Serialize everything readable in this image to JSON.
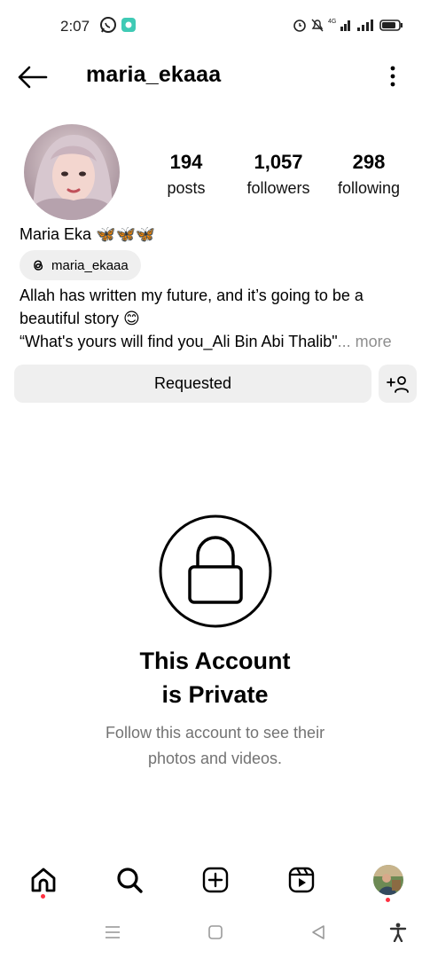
{
  "status_bar": {
    "time": "2:07",
    "icons": [
      "whatsapp-icon",
      "app-notification-icon",
      "alarm-icon",
      "mute-icon",
      "4g-signal-icon",
      "signal-icon",
      "battery-icon"
    ]
  },
  "header": {
    "username": "maria_ekaaa",
    "back_icon": "arrow-left-icon",
    "menu_icon": "more-vertical-icon"
  },
  "profile": {
    "stats": [
      {
        "value": "194",
        "label": "posts"
      },
      {
        "value": "1,057",
        "label": "followers"
      },
      {
        "value": "298",
        "label": "following"
      }
    ],
    "full_name": "Maria Eka 🦋🦋🦋",
    "threads_handle": "maria_ekaaa",
    "bio_line1": "Allah has written my future, and it’s going to be a",
    "bio_line2": "beautiful story 😊",
    "bio_line3": "“What's yours will find you_Ali Bin Abi Thalib\"",
    "bio_more": "... more"
  },
  "actions": {
    "requested_label": "Requested",
    "add_user_icon": "add-user-icon"
  },
  "private": {
    "title_line1": "This Account",
    "title_line2": "is Private",
    "subtitle_line1": "Follow this account to see their",
    "subtitle_line2": "photos and videos."
  },
  "bottom_nav": {
    "items": [
      "home-icon",
      "search-icon",
      "create-post-icon",
      "reels-icon",
      "profile-avatar"
    ]
  },
  "system_nav": {
    "items": [
      "recents-icon",
      "home-square-icon",
      "back-triangle-icon",
      "accessibility-icon"
    ]
  },
  "colors": {
    "button_bg": "#efefef",
    "muted_text": "#737373",
    "notification_dot": "#ff3040"
  }
}
